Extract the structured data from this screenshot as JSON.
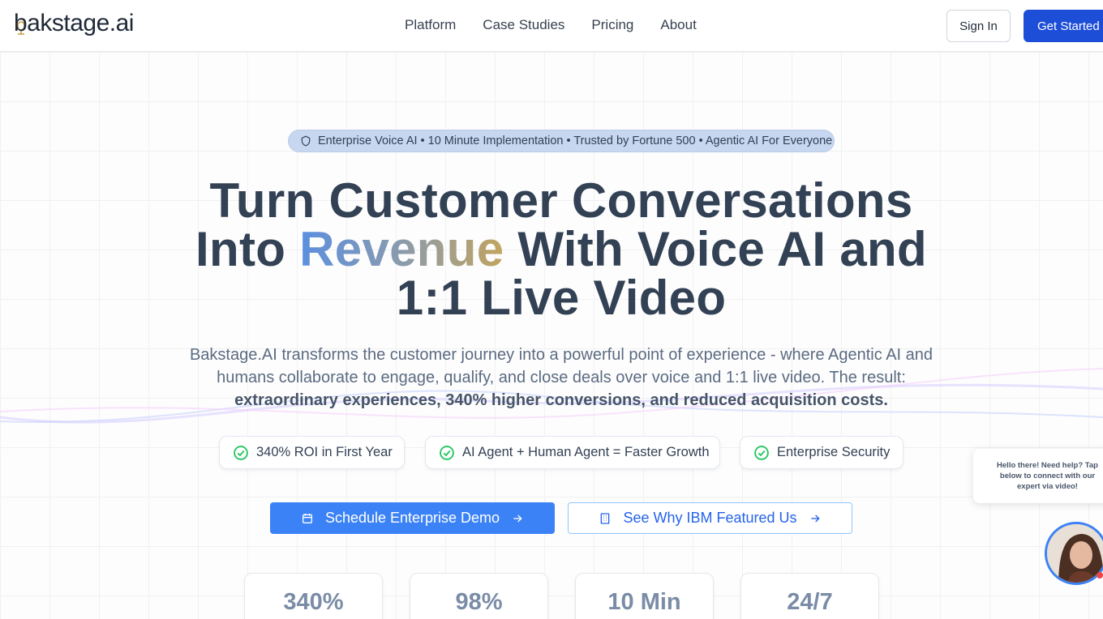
{
  "nav": {
    "logo": "bakstage.ai",
    "links": [
      "Platform",
      "Case Studies",
      "Pricing",
      "About"
    ],
    "sign_in": "Sign In",
    "get_started": "Get Started"
  },
  "hero": {
    "badge": "Enterprise Voice AI • 10 Minute Implementation • Trusted by Fortune 500 • Agentic AI For Everyone",
    "headline_line1": "Turn Customer Conversations",
    "headline_into": "Into ",
    "headline_highlight": "Revenue",
    "headline_rest": " With Voice AI and",
    "headline_line3": "1:1 Live Video",
    "subtext": "Bakstage.AI transforms the customer journey into a powerful point of experience - where Agentic AI and humans collaborate to engage, qualify, and close deals over voice and 1:1 live video. The result:",
    "subtext_bold": "extraordinary experiences, 340% higher conversions, and reduced acquisition costs."
  },
  "features": [
    "340% ROI in First Year",
    "AI Agent + Human Agent = Faster Growth",
    "Enterprise Security"
  ],
  "cta": {
    "primary": "Schedule Enterprise Demo",
    "secondary": "See Why IBM Featured Us"
  },
  "stats": [
    "340%",
    "98%",
    "10 Min",
    "24/7"
  ],
  "chat": {
    "message": "Hello there! Need help? Tap below to connect with our expert via video!"
  },
  "colors": {
    "primary": "#1d4ed8",
    "cta": "#3b82f6",
    "check": "#22c55e",
    "heading": "#334155"
  },
  "icons": {
    "badge": "shield-icon",
    "feature": "check-circle-icon",
    "primary_cta": "calendar-icon",
    "secondary_cta": "building-icon",
    "cta_arrow": "arrow-right-icon"
  }
}
